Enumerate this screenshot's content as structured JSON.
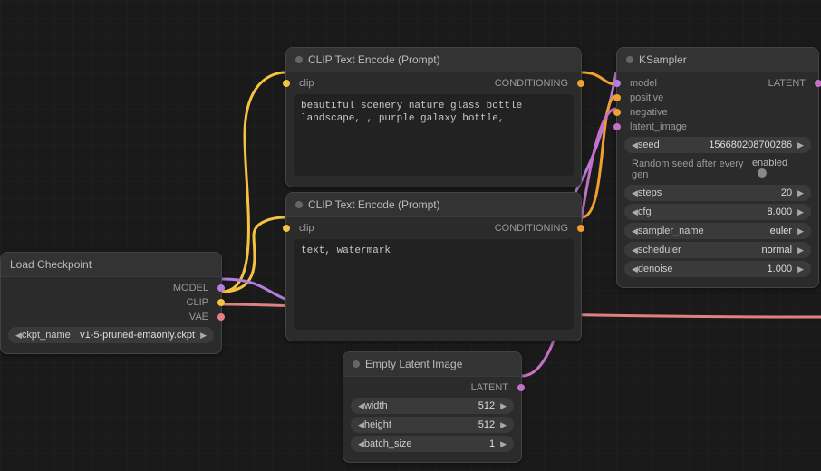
{
  "nodes": {
    "loadckpt": {
      "title": "Load Checkpoint",
      "outputs": {
        "model": "MODEL",
        "clip": "CLIP",
        "vae": "VAE"
      },
      "widgets": {
        "ckpt_name": {
          "label": "ckpt_name",
          "value": "v1-5-pruned-emaonly.ckpt"
        }
      }
    },
    "clip1": {
      "title": "CLIP Text Encode (Prompt)",
      "inputs": {
        "clip": "clip"
      },
      "outputs": {
        "cond": "CONDITIONING"
      },
      "prompt": "beautiful scenery nature glass bottle landscape, , purple galaxy bottle,"
    },
    "clip2": {
      "title": "CLIP Text Encode (Prompt)",
      "inputs": {
        "clip": "clip"
      },
      "outputs": {
        "cond": "CONDITIONING"
      },
      "prompt": "text, watermark"
    },
    "empty": {
      "title": "Empty Latent Image",
      "outputs": {
        "latent": "LATENT"
      },
      "widgets": {
        "width": {
          "label": "width",
          "value": "512"
        },
        "height": {
          "label": "height",
          "value": "512"
        },
        "batch_size": {
          "label": "batch_size",
          "value": "1"
        }
      }
    },
    "ksampler": {
      "title": "KSampler",
      "inputs": {
        "model": "model",
        "positive": "positive",
        "negative": "negative",
        "latent_image": "latent_image"
      },
      "outputs": {
        "latent": "LATENT"
      },
      "widgets": {
        "seed": {
          "label": "seed",
          "value": "156680208700286"
        },
        "random_toggle": {
          "label": "Random seed after every gen",
          "value": "enabled"
        },
        "steps": {
          "label": "steps",
          "value": "20"
        },
        "cfg": {
          "label": "cfg",
          "value": "8.000"
        },
        "sampler_name": {
          "label": "sampler_name",
          "value": "euler"
        },
        "scheduler": {
          "label": "scheduler",
          "value": "normal"
        },
        "denoise": {
          "label": "denoise",
          "value": "1.000"
        }
      }
    }
  }
}
